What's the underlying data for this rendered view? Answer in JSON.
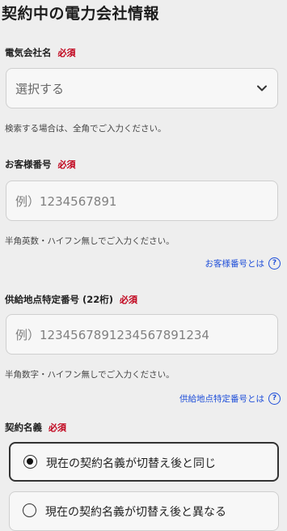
{
  "page": {
    "title": "契約中の電力会社情報"
  },
  "required_label": "必須",
  "company": {
    "label": "電気会社名",
    "select_value": "選択する",
    "hint": "検索する場合は、全角でご入力ください。"
  },
  "customer_number": {
    "label": "お客様番号",
    "placeholder": "例）1234567891",
    "hint": "半角英数・ハイフン無しでご入力ください。",
    "help_link": "お客様番号とは"
  },
  "supply_point": {
    "label": "供給地点特定番号 (22桁)",
    "placeholder": "例）1234567891234567891234",
    "hint": "半角数字・ハイフン無しでご入力ください。",
    "help_link": "供給地点特定番号とは"
  },
  "contract_name": {
    "label": "契約名義",
    "options": [
      {
        "label": "現在の契約名義が切替え後と同じ",
        "selected": true
      },
      {
        "label": "現在の契約名義が切替え後と異なる",
        "selected": false
      }
    ]
  },
  "icons": {
    "chevron": "chevron-down-icon",
    "help": "question-circle-icon",
    "help_glyph": "?"
  },
  "colors": {
    "required": "#c0001a",
    "link": "#1f4fd9"
  }
}
